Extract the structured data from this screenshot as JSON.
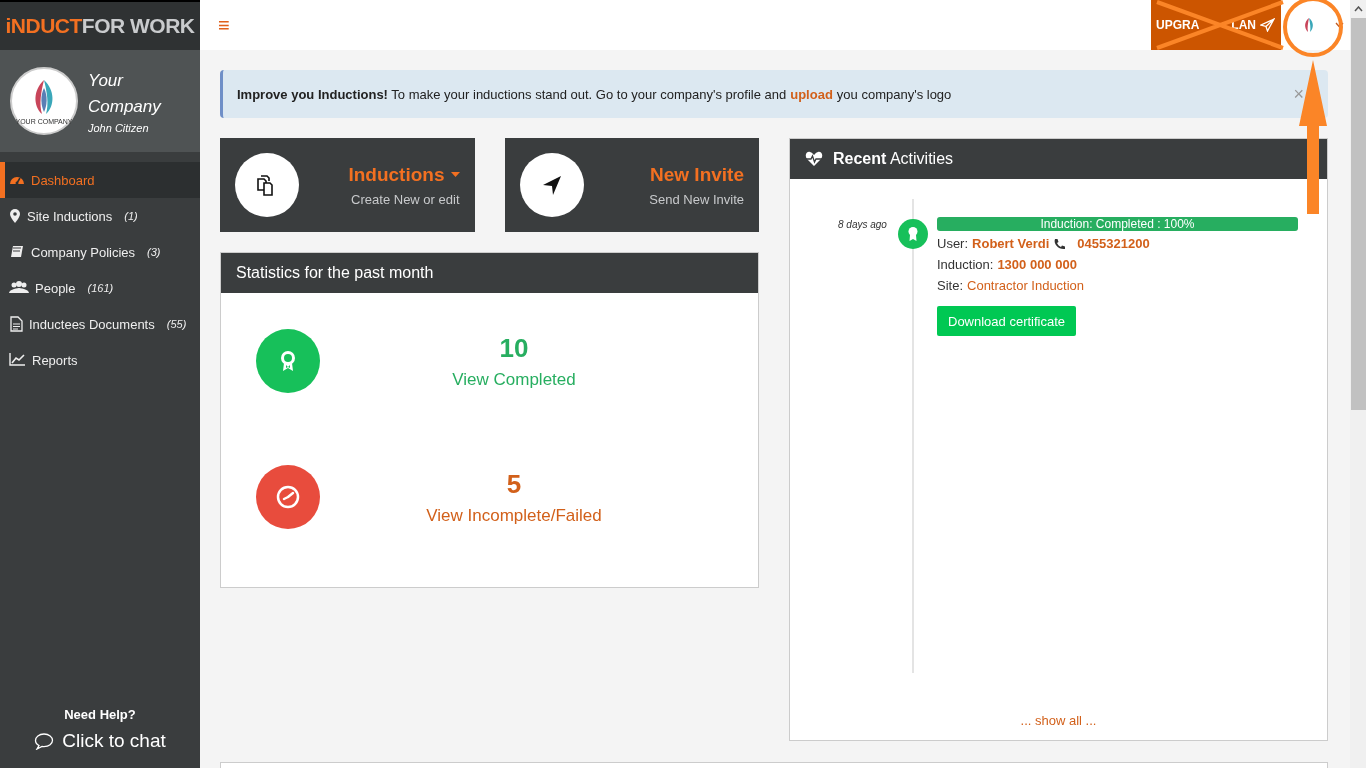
{
  "logo": {
    "brand": "iNDUCT",
    "suffix": "FOR WORK"
  },
  "header": {
    "menu_icon": "≡",
    "upgrade_button_start": "UPGRA",
    "upgrade_button_end": "LAN"
  },
  "profile": {
    "logo_text": "YOUR COMPANY",
    "company": "Your Company",
    "user": "John Citizen"
  },
  "nav": [
    {
      "label": "Dashboard",
      "selected": true
    },
    {
      "label": "Site Inductions",
      "count": "(1)",
      "selected": false
    },
    {
      "label": "Company Policies",
      "count": "(3)",
      "selected": false
    },
    {
      "label": "People",
      "count": "(161)",
      "selected": false
    },
    {
      "label": "Inductees Documents",
      "count": "(55)",
      "selected": false
    },
    {
      "label": "Reports",
      "selected": false
    }
  ],
  "help": {
    "title": "Need Help?",
    "chat": "Click to chat"
  },
  "alert": {
    "before": "**Improve you Inductions!** To make your inductions stand out. Go to your company's profile and",
    "link": "upload",
    "after": "you company's logo",
    "close": "×"
  },
  "tiles": [
    {
      "title": "Inductions",
      "subtitle": "Create New or edit",
      "dropdown": true
    },
    {
      "title": "New Invite",
      "subtitle": "Send New Invite",
      "dropdown": false
    }
  ],
  "statistics": {
    "title": "Statistics for the past month",
    "items": [
      {
        "kind": "completed",
        "count": "10",
        "link": "View Completed"
      },
      {
        "kind": "failed",
        "count": "5",
        "link": "View Incomplete/Failed"
      }
    ]
  },
  "recent": {
    "title": "**Recent** Activities",
    "items": [
      {
        "time": "8 days ago",
        "progress": {
          "label": "Induction: Completed : 100%",
          "level": 1
        },
        "user_label": "User:",
        "user": "Robert Verdi",
        "phone": "0455321200",
        "induction_label": "Induction:",
        "induction": "1300 000 000",
        "site_label": "Site:",
        "site": "Contractor Induction",
        "button": "Download certificate"
      }
    ],
    "show_all": "... show all ..."
  }
}
